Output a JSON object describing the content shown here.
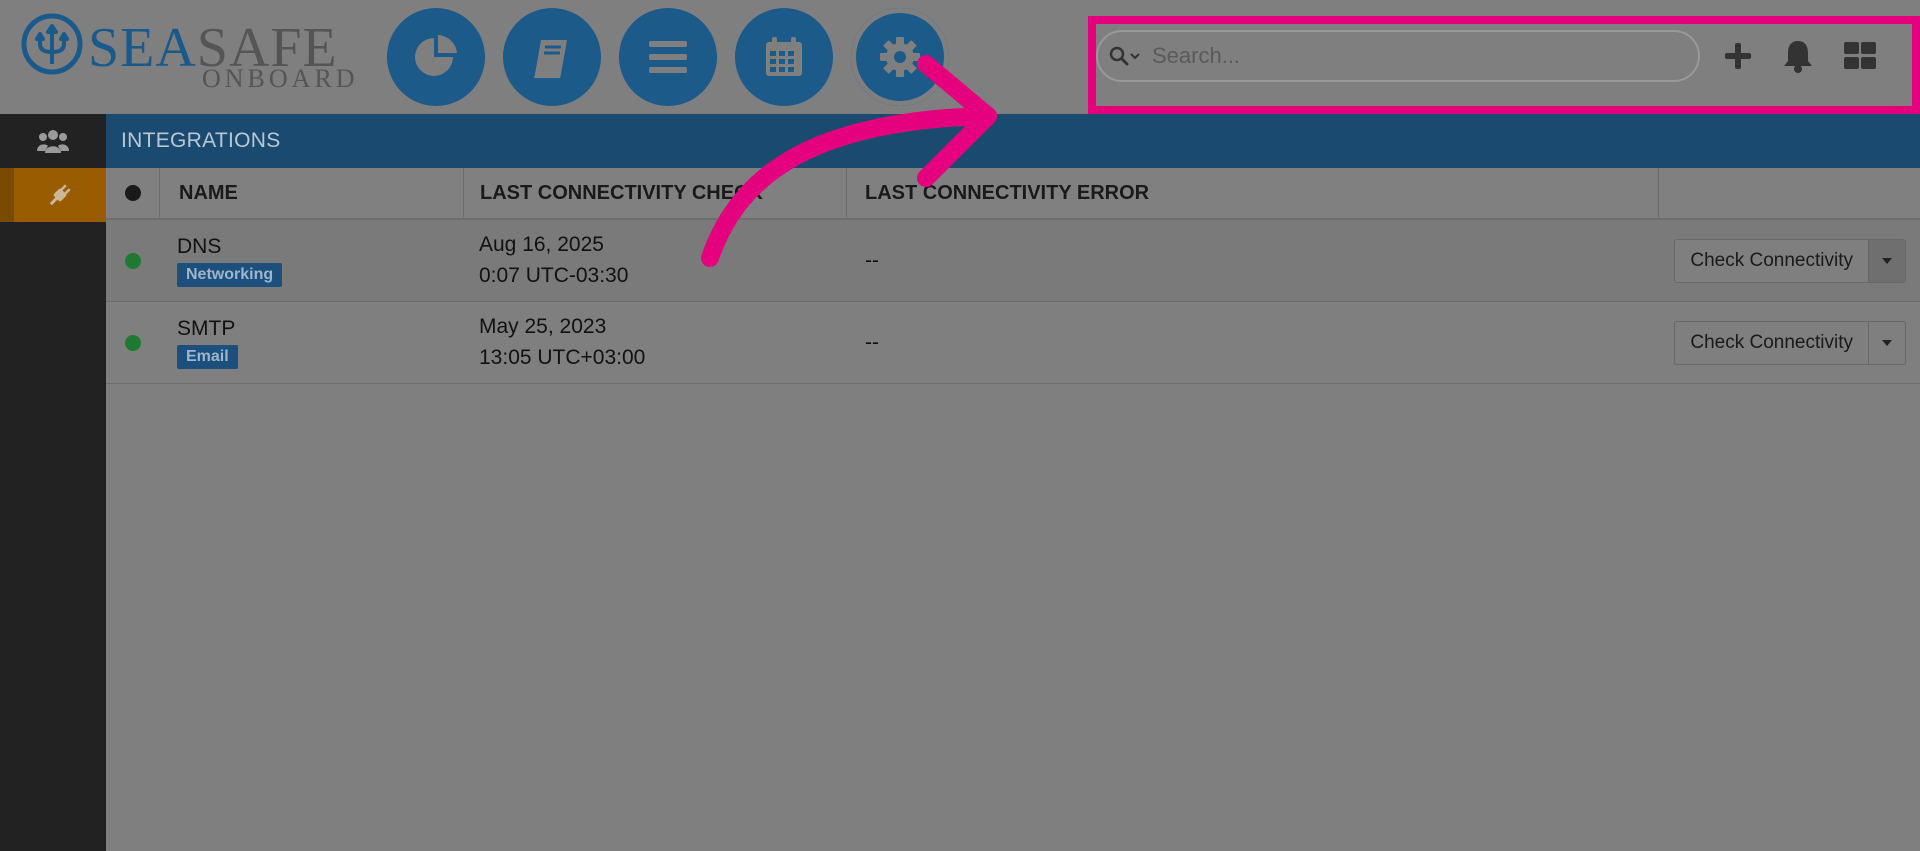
{
  "logo": {
    "word_sea": "SEA",
    "word_safe": "SAFE",
    "subtitle": "ONBOARD"
  },
  "header": {
    "nav": [
      {
        "icon": "pie-chart-icon"
      },
      {
        "icon": "book-icon"
      },
      {
        "icon": "menu-icon"
      },
      {
        "icon": "calendar-icon"
      },
      {
        "icon": "gear-icon",
        "active": true
      }
    ],
    "search": {
      "placeholder": "Search..."
    },
    "actions": [
      "plus-icon",
      "bell-icon",
      "grid-icon"
    ]
  },
  "sidebar": {
    "items": [
      {
        "icon": "users-icon",
        "active": false
      },
      {
        "icon": "plug-icon",
        "active": true
      }
    ]
  },
  "section": {
    "title": "INTEGRATIONS"
  },
  "table": {
    "columns": {
      "name": "NAME",
      "last_check": "LAST CONNECTIVITY CHECK",
      "last_error": "LAST CONNECTIVITY ERROR"
    },
    "rows": [
      {
        "name": "DNS",
        "tag": "Networking",
        "date": "Aug 16, 2025",
        "time": "0:07 UTC-03:30",
        "error": "--",
        "action": "Check Connectivity"
      },
      {
        "name": "SMTP",
        "tag": "Email",
        "date": "May 25, 2023",
        "time": "13:05 UTC+03:00",
        "error": "--",
        "action": "Check Connectivity"
      }
    ]
  },
  "colors": {
    "brand_blue": "#1c5a8a",
    "highlight": "#e5007e",
    "status_ok": "#1e7a30",
    "active_side": "#9a5c00"
  }
}
